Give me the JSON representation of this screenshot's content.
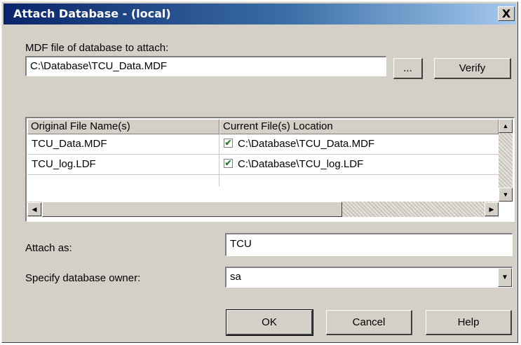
{
  "window": {
    "title": "Attach Database - (local)",
    "close_glyph": "X"
  },
  "mdf": {
    "label": "MDF file of database to attach:",
    "value": "C:\\Database\\TCU_Data.MDF",
    "browse_label": "...",
    "verify_label": "Verify"
  },
  "grid": {
    "columns": [
      "Original File Name(s)",
      "Current File(s) Location"
    ],
    "rows": [
      {
        "original": "TCU_Data.MDF",
        "checked": true,
        "location": "C:\\Database\\TCU_Data.MDF"
      },
      {
        "original": "TCU_log.LDF",
        "checked": true,
        "location": "C:\\Database\\TCU_log.LDF"
      }
    ],
    "check_glyph": "✔",
    "scroll": {
      "up": "▲",
      "down": "▼",
      "left": "◀",
      "right": "▶"
    }
  },
  "attach_as": {
    "label": "Attach as:",
    "value": "TCU"
  },
  "owner": {
    "label": "Specify database owner:",
    "value": "sa",
    "dropdown_glyph": "▼"
  },
  "buttons": {
    "ok": "OK",
    "cancel": "Cancel",
    "help": "Help"
  },
  "colors": {
    "face": "#d4d0c8",
    "title_start": "#0a246a",
    "title_end": "#a6caf0",
    "check": "#2c7a2c"
  }
}
